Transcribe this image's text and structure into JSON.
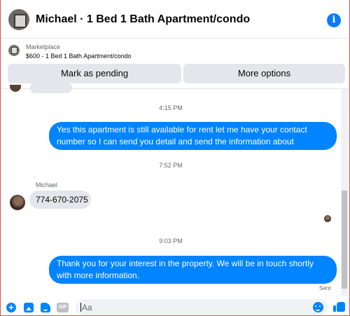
{
  "header": {
    "title": "Michael · 1 Bed 1 Bath Apartment/condo",
    "info_icon_glyph": "i"
  },
  "marketplace": {
    "label": "Marketplace",
    "listing": "$600 - 1 Bed 1 Bath Apartment/condo",
    "mark_pending_label": "Mark as pending",
    "more_options_label": "More options"
  },
  "messages": {
    "timestamp_1": "4:15 PM",
    "outgoing_1": "Yes this apartment is still available for rent let me have your contact number so I can send you detail and send the information about apartment",
    "timestamp_2": "7:52 PM",
    "sender_name": "Michael",
    "incoming_1": "774-670-2075",
    "timestamp_3": "9:03 PM",
    "outgoing_2": "Thank you for your interest in the property. We will be in touch shortly with more information.",
    "status": "Sent"
  },
  "composer": {
    "plus_glyph": "+",
    "gif_label": "GIF",
    "placeholder": "Aa"
  },
  "icons": [
    "info-icon",
    "plus-icon",
    "photo-icon",
    "sticker-icon",
    "gif-icon",
    "emoji-icon",
    "thumbs-up-icon"
  ],
  "colors": {
    "accent": "#0084ff",
    "info_blue": "#0a7cff",
    "incoming_bubble": "#e4e6eb",
    "secondary_text": "#65676b"
  }
}
